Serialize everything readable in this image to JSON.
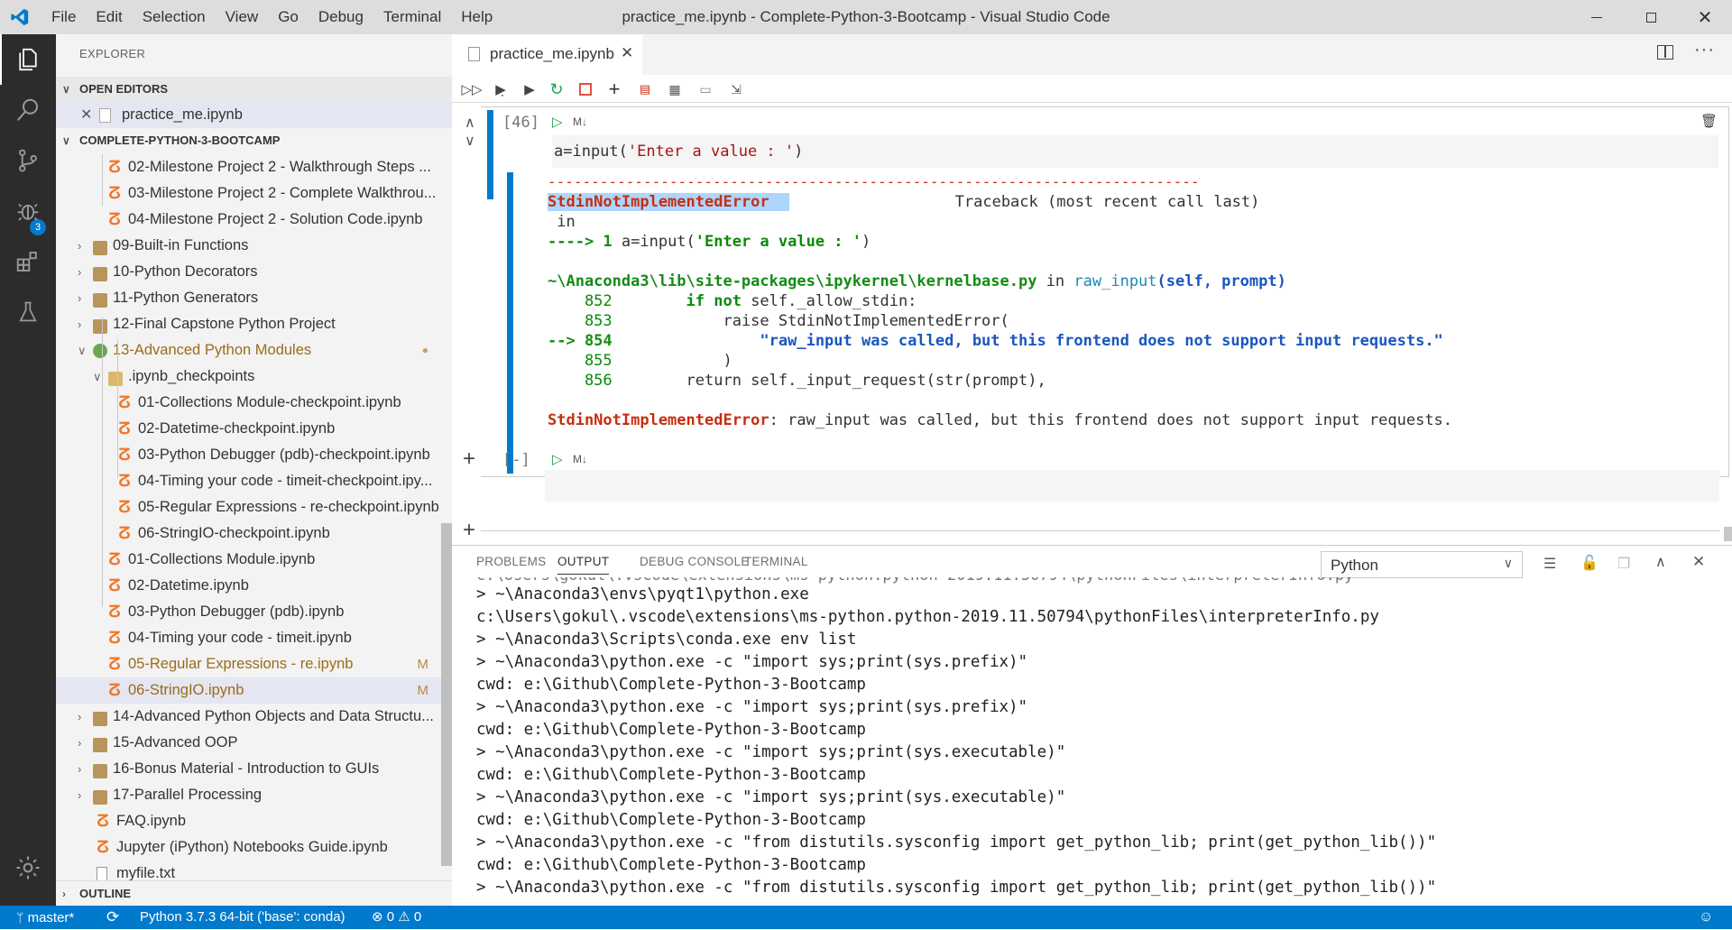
{
  "titlebar": {
    "menu": [
      "File",
      "Edit",
      "Selection",
      "View",
      "Go",
      "Debug",
      "Terminal",
      "Help"
    ],
    "title": "practice_me.ipynb - Complete-Python-3-Bootcamp - Visual Studio Code"
  },
  "activity": {
    "scm_badge": "3"
  },
  "sidebar": {
    "title": "EXPLORER",
    "open_editors_header": "OPEN EDITORS",
    "open_editor_file": "practice_me.ipynb",
    "project_header": "COMPLETE-PYTHON-3-BOOTCAMP",
    "outline_header": "OUTLINE",
    "items": [
      {
        "label": "02-Milestone Project 2 - Walkthrough Steps ...",
        "type": "nb"
      },
      {
        "label": "03-Milestone Project 2 - Complete Walkthrou...",
        "type": "nb"
      },
      {
        "label": "04-Milestone Project 2 - Solution Code.ipynb",
        "type": "nb"
      },
      {
        "label": "09-Built-in Functions",
        "type": "folder"
      },
      {
        "label": "10-Python Decorators",
        "type": "folder"
      },
      {
        "label": "11-Python Generators",
        "type": "folder"
      },
      {
        "label": "12-Final Capstone Python Project",
        "type": "folder"
      },
      {
        "label": "13-Advanced Python Modules",
        "type": "folder-open",
        "modified": "●"
      },
      {
        "label": ".ipynb_checkpoints",
        "type": "folder-open"
      },
      {
        "label": "01-Collections Module-checkpoint.ipynb",
        "type": "nb"
      },
      {
        "label": "02-Datetime-checkpoint.ipynb",
        "type": "nb"
      },
      {
        "label": "03-Python Debugger (pdb)-checkpoint.ipynb",
        "type": "nb"
      },
      {
        "label": "04-Timing your code - timeit-checkpoint.ipy...",
        "type": "nb"
      },
      {
        "label": "05-Regular Expressions - re-checkpoint.ipynb",
        "type": "nb"
      },
      {
        "label": "06-StringIO-checkpoint.ipynb",
        "type": "nb"
      },
      {
        "label": "01-Collections Module.ipynb",
        "type": "nb"
      },
      {
        "label": "02-Datetime.ipynb",
        "type": "nb"
      },
      {
        "label": "03-Python Debugger (pdb).ipynb",
        "type": "nb"
      },
      {
        "label": "04-Timing your code - timeit.ipynb",
        "type": "nb"
      },
      {
        "label": "05-Regular Expressions - re.ipynb",
        "type": "nb",
        "modified": "M"
      },
      {
        "label": "06-StringIO.ipynb",
        "type": "nb",
        "modified": "M"
      },
      {
        "label": "14-Advanced Python Objects and Data Structu...",
        "type": "folder"
      },
      {
        "label": "15-Advanced OOP",
        "type": "folder"
      },
      {
        "label": "16-Bonus Material - Introduction to GUIs",
        "type": "folder"
      },
      {
        "label": "17-Parallel Processing",
        "type": "folder"
      },
      {
        "label": "FAQ.ipynb",
        "type": "nb"
      },
      {
        "label": "Jupyter (iPython) Notebooks Guide.ipynb",
        "type": "nb"
      },
      {
        "label": "myfile.txt",
        "type": "txt"
      }
    ]
  },
  "editor": {
    "tab_label": "practice_me.ipynb",
    "cell1": {
      "count": "[46]",
      "md": "M↓",
      "code_fn": "a=input(",
      "code_str": "'Enter a value : '",
      "code_end": ")"
    },
    "output": {
      "dashes": "---------------------------------------------------------------------------",
      "err_name": "StdinNotImplementedError",
      "traceback": "Traceback (most recent call last)",
      "in_label": " in",
      "arrow1": "----> 1 ",
      "arrow1_code": "a=input(",
      "arrow1_str": "'Enter a value : '",
      "arrow1_end": ")",
      "path": "~\\Anaconda3\\lib\\site-packages\\ipykernel\\kernelbase.py",
      "in_word": " in ",
      "fn": "raw_input",
      "fn_args": "(self, prompt)",
      "l852_no": "    852",
      "l852_kw": "        if not ",
      "l852_rest": "self._allow_stdin:",
      "l853_no": "    853",
      "l853_rest": "            raise StdinNotImplementedError(",
      "l854_arrow": "--> 854",
      "l854_str": "                \"raw_input was called, but this frontend does not support input requests.\"",
      "l855_no": "    855",
      "l855_rest": "            )",
      "l856_no": "    856",
      "l856_rest": "        return self._input_request(str(prompt),",
      "final_name": "StdinNotImplementedError",
      "final_msg": ": raw_input was called, but this frontend does not support input requests."
    },
    "cell2": {
      "count": "[-]",
      "md": "M↓"
    }
  },
  "panel": {
    "tabs": [
      "PROBLEMS",
      "OUTPUT",
      "DEBUG CONSOLE",
      "TERMINAL"
    ],
    "active_tab": "OUTPUT",
    "select_value": "Python",
    "lines": [
      "> ~\\Anaconda3\\envs\\pyqt1\\python.exe",
      "c:\\Users\\gokul\\.vscode\\extensions\\ms-python.python-2019.11.50794\\pythonFiles\\interpreterInfo.py",
      "> ~\\Anaconda3\\Scripts\\conda.exe env list",
      "> ~\\Anaconda3\\python.exe -c \"import sys;print(sys.prefix)\"",
      "cwd: e:\\Github\\Complete-Python-3-Bootcamp",
      "> ~\\Anaconda3\\python.exe -c \"import sys;print(sys.prefix)\"",
      "cwd: e:\\Github\\Complete-Python-3-Bootcamp",
      "> ~\\Anaconda3\\python.exe -c \"import sys;print(sys.executable)\"",
      "cwd: e:\\Github\\Complete-Python-3-Bootcamp",
      "> ~\\Anaconda3\\python.exe -c \"import sys;print(sys.executable)\"",
      "cwd: e:\\Github\\Complete-Python-3-Bootcamp",
      "> ~\\Anaconda3\\python.exe -c \"from distutils.sysconfig import get_python_lib; print(get_python_lib())\"",
      "cwd: e:\\Github\\Complete-Python-3-Bootcamp",
      "> ~\\Anaconda3\\python.exe -c \"from distutils.sysconfig import get_python_lib; print(get_python_lib())\""
    ]
  },
  "statusbar": {
    "branch": "master*",
    "python": "Python 3.7.3 64-bit ('base': conda)",
    "errors": "0",
    "warnings": "0"
  },
  "colors": {
    "accent": "#007acc",
    "activitybar": "#2c2c2c",
    "sidebar": "#f3f3f3",
    "error_red": "#c72e0f",
    "traceback_green": "#148c14"
  }
}
